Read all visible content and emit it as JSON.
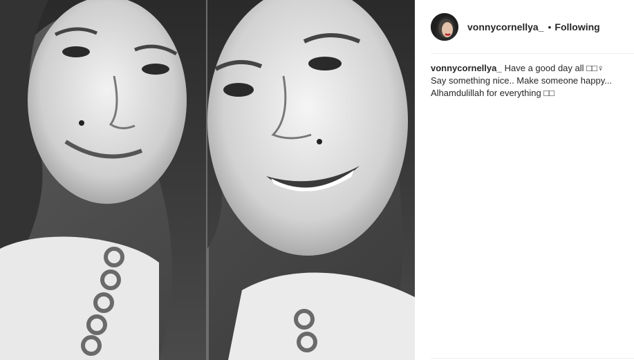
{
  "post": {
    "username": "vonnycornellya_",
    "separator": "•",
    "follow_status": "Following",
    "caption": {
      "username": "vonnycornellya_",
      "line1": "Have a good day all □□♀",
      "line2": "Say something nice.. Make someone happy...",
      "line3": "Alhamdulillah for everything □□"
    }
  },
  "colors": {
    "text": "#262626",
    "divider": "#efefef",
    "background": "#ffffff"
  },
  "icons": {
    "avatar": "profile-avatar"
  }
}
